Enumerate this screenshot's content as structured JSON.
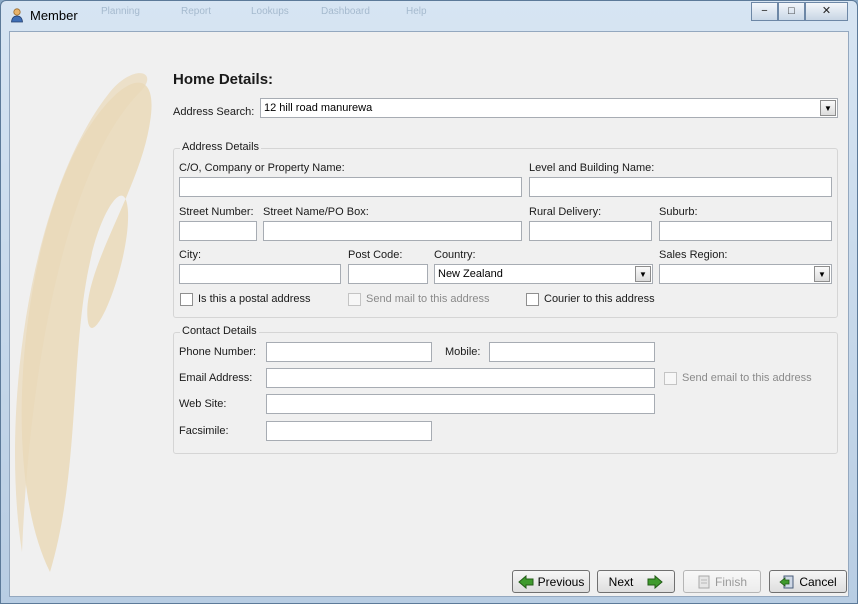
{
  "window": {
    "title": "Member",
    "background_menu": [
      "Planning",
      "Report",
      "Lookups",
      "Dashboard",
      "Help"
    ]
  },
  "home": {
    "heading": "Home Details:",
    "address_search_label": "Address Search:",
    "address_search_value": "12 hill road manurewa"
  },
  "address": {
    "group_title": "Address Details",
    "co_label": "C/O, Company or Property Name:",
    "co_value": "",
    "level_label": "Level and Building Name:",
    "level_value": "",
    "street_number_label": "Street Number:",
    "street_number_value": "",
    "street_name_label": "Street Name/PO Box:",
    "street_name_value": "",
    "rural_label": "Rural Delivery:",
    "rural_value": "",
    "suburb_label": "Suburb:",
    "suburb_value": "",
    "city_label": "City:",
    "city_value": "",
    "postcode_label": "Post Code:",
    "postcode_value": "",
    "country_label": "Country:",
    "country_value": "New Zealand",
    "region_label": "Sales Region:",
    "region_value": "",
    "postal_label": "Is this a postal address",
    "postal_checked": false,
    "sendmail_label": "Send mail to this address",
    "sendmail_checked": false,
    "courier_label": "Courier to this address",
    "courier_checked": false
  },
  "contact": {
    "group_title": "Contact Details",
    "phone_label": "Phone Number:",
    "phone_value": "",
    "mobile_label": "Mobile:",
    "mobile_value": "",
    "email_label": "Email Address:",
    "email_value": "",
    "sendemail_label": "Send email to this address",
    "sendemail_checked": false,
    "website_label": "Web Site:",
    "website_value": "",
    "fax_label": "Facsimile:",
    "fax_value": ""
  },
  "footer": {
    "previous_label": "Previous",
    "next_label": "Next",
    "finish_label": "Finish",
    "cancel_label": "Cancel"
  },
  "colors": {
    "swirl": "#ead9b8",
    "arrow_green": "#3f9b2d"
  }
}
